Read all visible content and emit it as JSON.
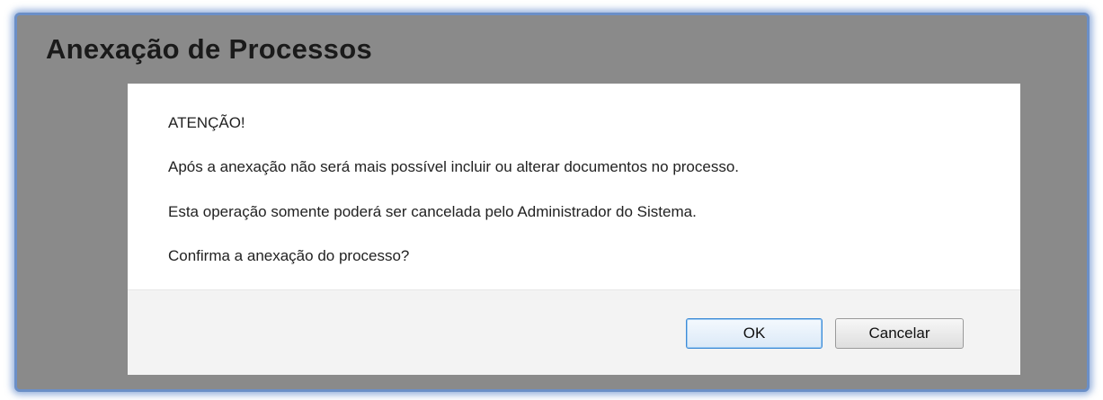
{
  "page": {
    "title": "Anexação de Processos"
  },
  "dialog": {
    "heading": "ATENÇÃO!",
    "line_1": "Após a anexação não será mais possível incluir ou alterar documentos no processo.",
    "line_2": "Esta operação somente poderá ser cancelada pelo Administrador do Sistema.",
    "question": "Confirma a anexação do processo?",
    "ok_label": "OK",
    "cancel_label": "Cancelar"
  },
  "colors": {
    "frame_border": "#6b8fc7",
    "overlay": "#8a8a8a",
    "primary_button_border": "#3d8bd6"
  }
}
